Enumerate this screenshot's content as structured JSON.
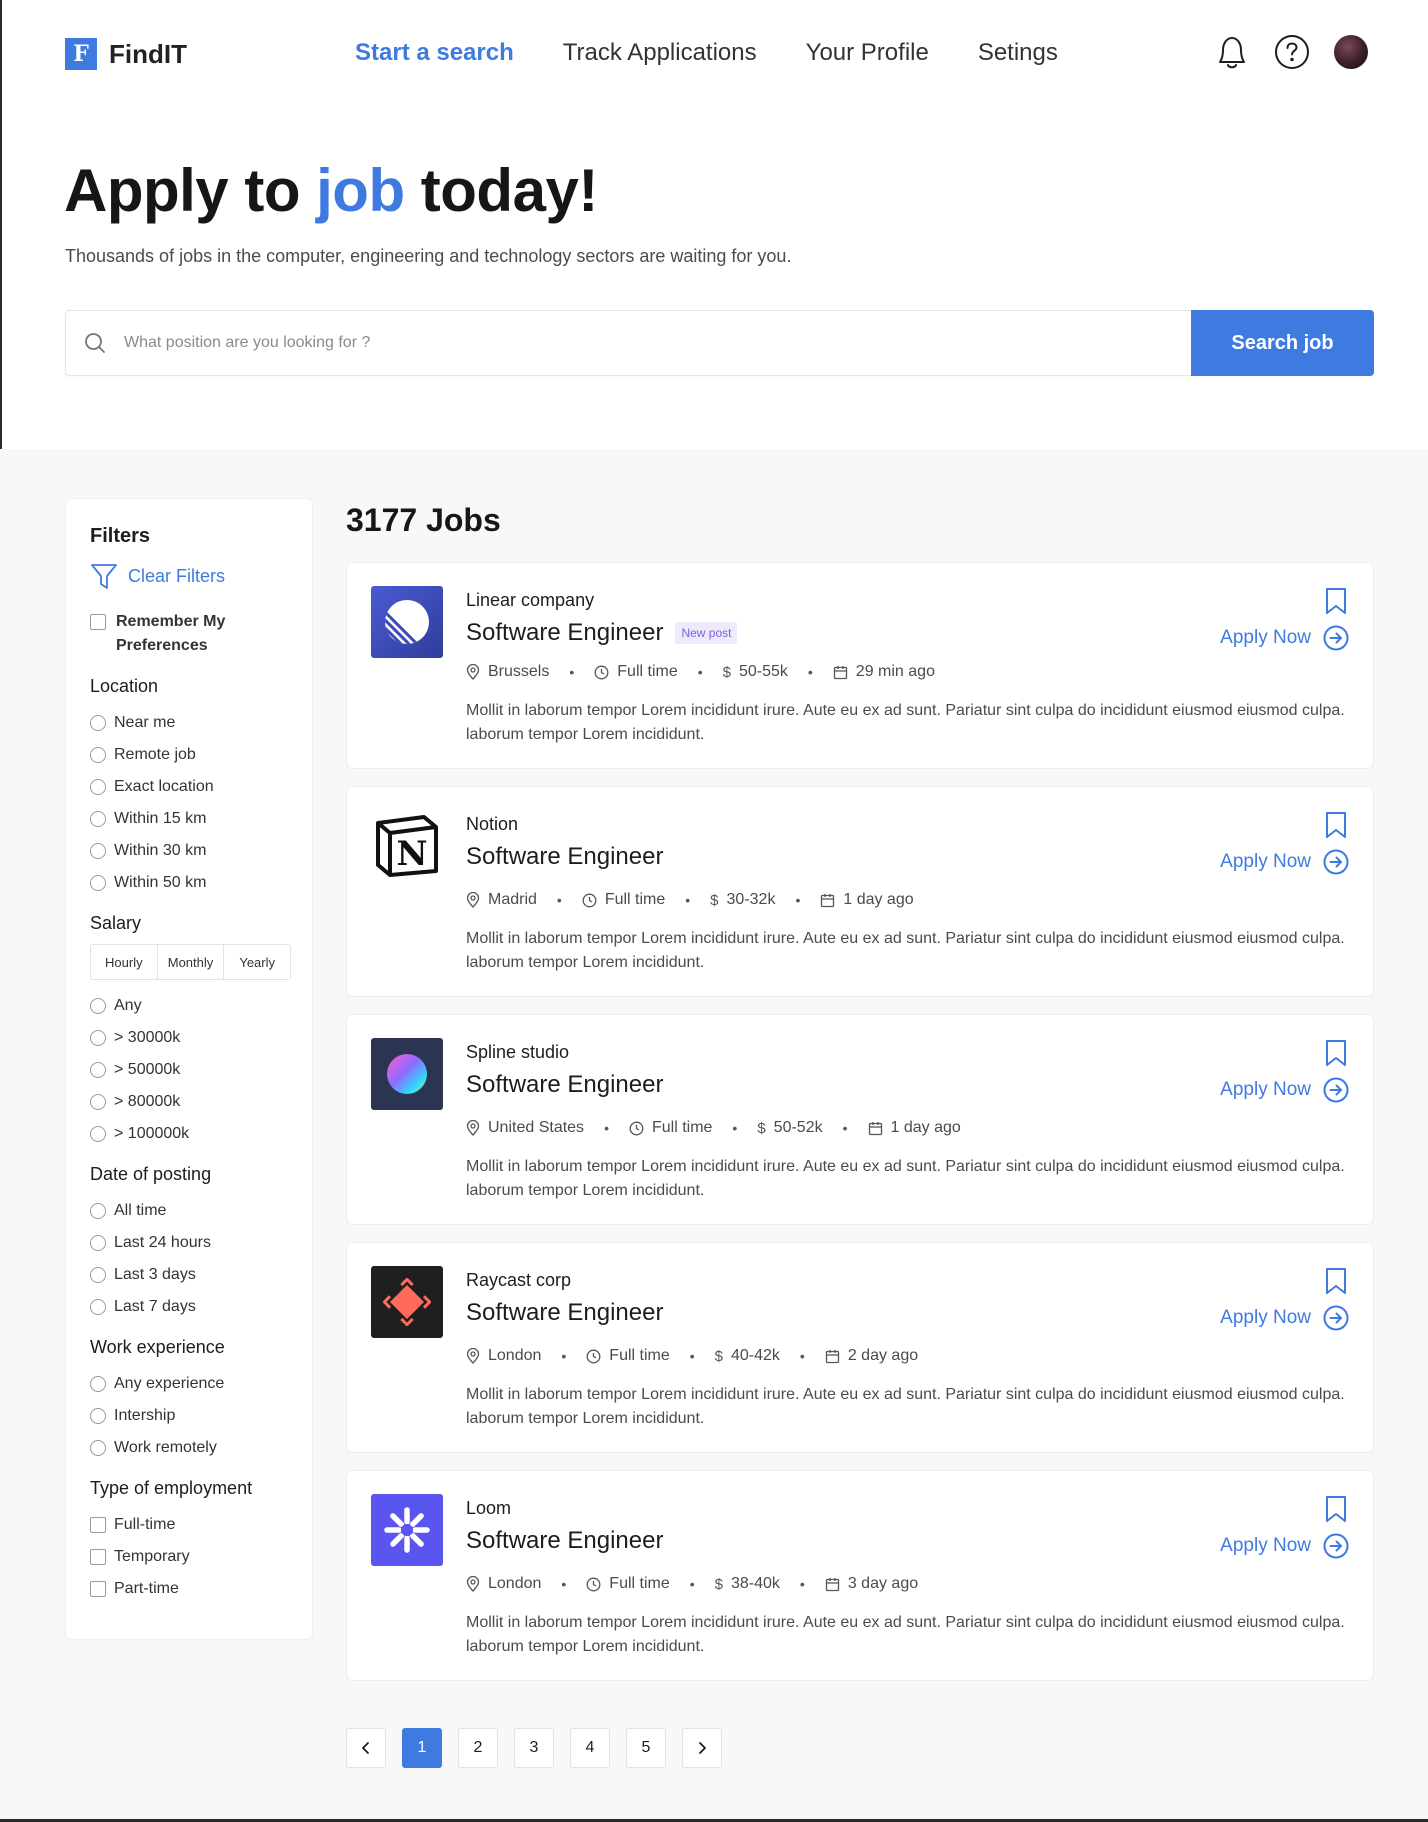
{
  "brand": {
    "logo_letter": "F",
    "name": "FindIT",
    "accent_color": "#3f7ae0"
  },
  "nav": {
    "items": [
      {
        "label": "Start a search",
        "active": true
      },
      {
        "label": "Track Applications",
        "active": false
      },
      {
        "label": "Your Profile",
        "active": false
      },
      {
        "label": "Setings",
        "active": false
      }
    ],
    "icons": [
      "bell-icon",
      "help-icon",
      "avatar"
    ]
  },
  "hero": {
    "title_before": "Apply to ",
    "title_accent": "job",
    "title_after": " today!",
    "subtitle": "Thousands of jobs in the computer, engineering and technology sectors are waiting for you."
  },
  "search": {
    "placeholder": "What position are you looking for ?",
    "value": "",
    "button_label": "Search job"
  },
  "filters": {
    "title": "Filters",
    "clear_label": "Clear Filters",
    "remember_label": "Remember My Preferences",
    "location": {
      "title": "Location",
      "options": [
        "Near me",
        "Remote job",
        "Exact location",
        "Within 15 km",
        "Within 30 km",
        "Within 50 km"
      ]
    },
    "salary": {
      "title": "Salary",
      "tabs": [
        "Hourly",
        "Monthly",
        "Yearly"
      ],
      "options": [
        "Any",
        "> 30000k",
        "> 50000k",
        "> 80000k",
        "> 100000k"
      ]
    },
    "date": {
      "title": "Date of posting",
      "options": [
        "All time",
        "Last 24 hours",
        "Last 3 days",
        "Last 7 days"
      ]
    },
    "experience": {
      "title": "Work experience",
      "options": [
        "Any experience",
        "Intership",
        "Work remotely"
      ]
    },
    "employment": {
      "title": "Type of employment",
      "options": [
        "Full-time",
        "Temporary",
        "Part-time"
      ]
    }
  },
  "jobs": {
    "count_label": "3177 Jobs",
    "apply_label": "Apply Now",
    "list": [
      {
        "company": "Linear company",
        "title": "Software Engineer",
        "badge": "New post",
        "location": "Brussels",
        "type": "Full time",
        "salary": "50-55k",
        "posted": "29 min ago",
        "description": "Mollit in laborum tempor Lorem incididunt irure. Aute eu ex ad sunt. Pariatur sint culpa do incididunt eiusmod eiusmod culpa. laborum tempor Lorem incididunt.",
        "logo": "linear-logo"
      },
      {
        "company": "Notion",
        "title": "Software Engineer",
        "badge": "",
        "location": "Madrid",
        "type": "Full time",
        "salary": "30-32k",
        "posted": "1 day ago",
        "description": "Mollit in laborum tempor Lorem incididunt irure. Aute eu ex ad sunt. Pariatur sint culpa do incididunt eiusmod eiusmod culpa. laborum tempor Lorem incididunt.",
        "logo": "notion-logo"
      },
      {
        "company": "Spline studio",
        "title": "Software Engineer",
        "badge": "",
        "location": "United States",
        "type": "Full time",
        "salary": "50-52k",
        "posted": "1 day ago",
        "description": "Mollit in laborum tempor Lorem incididunt irure. Aute eu ex ad sunt. Pariatur sint culpa do incididunt eiusmod eiusmod culpa. laborum tempor Lorem incididunt.",
        "logo": "spline-logo"
      },
      {
        "company": "Raycast corp",
        "title": "Software Engineer",
        "badge": "",
        "location": "London",
        "type": "Full time",
        "salary": "40-42k",
        "posted": "2 day ago",
        "description": "Mollit in laborum tempor Lorem incididunt irure. Aute eu ex ad sunt. Pariatur sint culpa do incididunt eiusmod eiusmod culpa. laborum tempor Lorem incididunt.",
        "logo": "raycast-logo"
      },
      {
        "company": "Loom",
        "title": "Software Engineer",
        "badge": "",
        "location": "London",
        "type": "Full time",
        "salary": "38-40k",
        "posted": "3 day ago",
        "description": "Mollit in laborum tempor Lorem incididunt irure. Aute eu ex ad sunt. Pariatur sint culpa do incididunt eiusmod eiusmod culpa. laborum tempor Lorem incididunt.",
        "logo": "loom-logo"
      }
    ]
  },
  "pagination": {
    "pages": [
      "1",
      "2",
      "3",
      "4",
      "5"
    ],
    "current": "1"
  }
}
